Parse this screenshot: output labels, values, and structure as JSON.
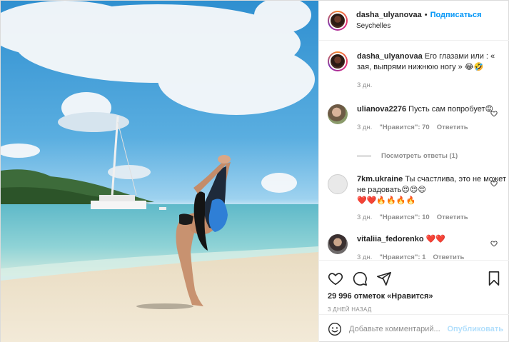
{
  "post": {
    "username": "dasha_ulyanovaa",
    "follow_label": "Подписаться",
    "separator": "•",
    "location": "Seychelles",
    "photo_alt": ""
  },
  "caption": {
    "username": "dasha_ulyanovaa",
    "text": "Его глазами или : « зая, выпрями нижнюю ногу » 😂🤣",
    "time": "3 дн."
  },
  "comments": [
    {
      "username": "ulianova2276",
      "text": "Пусть сам попробует😡",
      "time": "3 дн.",
      "likes_label": "\"Нравится\": 70",
      "reply_label": "Ответить",
      "view_replies": "Посмотреть ответы (1)"
    },
    {
      "username": "7km.ukraine",
      "text": "Ты счастлива, это не может не радовать😍😍😍",
      "text2": "❤️❤️🔥🔥🔥🔥",
      "time": "3 дн.",
      "likes_label": "\"Нравится\": 10",
      "reply_label": "Ответить"
    },
    {
      "username": "vitaliia_fedorenko",
      "text": "❤️❤️",
      "time": "3 дн.",
      "likes_label": "\"Нравится\": 1",
      "reply_label": "Ответить"
    }
  ],
  "actions": {
    "likes_count": "29 996",
    "likes_text": "отметок «Нравится»",
    "posted_ago": "3 ДНЕЙ НАЗАД"
  },
  "add_comment": {
    "placeholder": "Добавьте комментарий...",
    "publish_label": "Опубликовать"
  },
  "icons": {
    "like": "heart-icon",
    "comment": "comment-icon",
    "share": "share-icon",
    "save": "bookmark-icon",
    "emoji": "emoji-icon"
  }
}
